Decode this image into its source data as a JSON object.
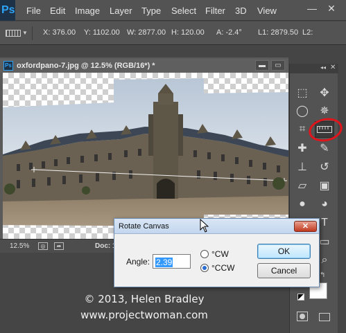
{
  "app": {
    "logo": "Ps"
  },
  "menu": [
    "File",
    "Edit",
    "Image",
    "Layer",
    "Type",
    "Select",
    "Filter",
    "3D",
    "View"
  ],
  "window_controls": {
    "minimize": "—",
    "close": "✕"
  },
  "options_bar": {
    "tool_icon": "ruler-icon",
    "x": "X: 376.00",
    "y": "Y: 1102.00",
    "w": "W: 2877.00",
    "h": "H: 120.00",
    "a": "A: -2.4°",
    "l1": "L1: 2879.50",
    "l2": "L2:"
  },
  "document": {
    "title": "oxfordpano-7.jpg @ 12.5% (RGB/16*) *",
    "icon_label": "Ps",
    "zoom": "12.5%",
    "doc_size_prefix": "Doc: 1"
  },
  "tools_panel": {
    "collapse": "◂◂",
    "close": "✕",
    "tools": [
      "marquee-icon",
      "move-icon",
      "lasso-icon",
      "magic-wand-icon",
      "crop-icon",
      "ruler-icon",
      "healing-brush-icon",
      "brush-icon",
      "clone-stamp-icon",
      "history-brush-icon",
      "eraser-icon",
      "gradient-icon",
      "blur-icon",
      "dodge-icon",
      "pen-icon",
      "type-icon",
      "path-selection-icon",
      "shape-icon",
      "hand-icon",
      "zoom-icon"
    ],
    "selected_tool": "ruler-icon",
    "foreground_color": "#000000",
    "background_color": "#ffffff"
  },
  "annotation": {
    "color": "#e0141b"
  },
  "dialog": {
    "title": "Rotate Canvas",
    "close": "✕",
    "angle_label": "Angle:",
    "angle_value": "2.39",
    "options": [
      {
        "label": "°CW",
        "checked": false
      },
      {
        "label": "°CCW",
        "checked": true
      }
    ],
    "ok": "OK",
    "cancel": "Cancel"
  },
  "watermark": {
    "line1": "© 2013, Helen Bradley",
    "line2": "www.projectwoman.com"
  }
}
